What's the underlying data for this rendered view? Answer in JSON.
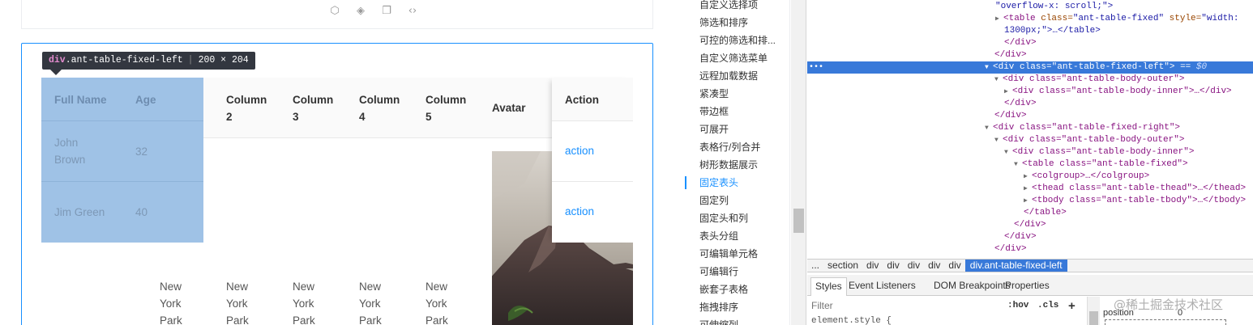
{
  "demo": {
    "toolbar_icons": [
      "codesandbox-icon",
      "codepen-icon",
      "copy-icon",
      "code-expand-icon"
    ],
    "tooltip": {
      "tag": "div",
      "cls": ".ant-table-fixed-left",
      "dims": "200 × 204"
    },
    "columns": {
      "full_name": "Full Name",
      "age": "Age",
      "c2a": "Column",
      "c2b": "2",
      "c3a": "Column",
      "c3b": "3",
      "c4a": "Column",
      "c4b": "4",
      "c5a": "Column",
      "c5b": "5",
      "avatar": "Avatar",
      "action": "Action"
    },
    "rows": [
      {
        "name_a": "John",
        "name_b": "Brown",
        "age": "32",
        "action": "action"
      },
      {
        "name": "Jim Green",
        "age": "40",
        "action": "action"
      }
    ],
    "address": {
      "l1": "New",
      "l2": "York",
      "l3": "Park"
    }
  },
  "sidebar": {
    "items": [
      {
        "label": "自定义选择项"
      },
      {
        "label": "筛选和排序"
      },
      {
        "label": "可控的筛选和排..."
      },
      {
        "label": "自定义筛选菜单"
      },
      {
        "label": "远程加载数据"
      },
      {
        "label": "紧凑型"
      },
      {
        "label": "带边框"
      },
      {
        "label": "可展开"
      },
      {
        "label": "表格行/列合并"
      },
      {
        "label": "树形数据展示"
      },
      {
        "label": "固定表头",
        "active": true
      },
      {
        "label": "固定列"
      },
      {
        "label": "固定头和列"
      },
      {
        "label": "表头分组"
      },
      {
        "label": "可编辑单元格"
      },
      {
        "label": "可编辑行"
      },
      {
        "label": "嵌套子表格"
      },
      {
        "label": "拖拽排序"
      },
      {
        "label": "可伸缩列"
      }
    ]
  },
  "devtools": {
    "lines": {
      "l0": "\"overflow-x: scroll;\">",
      "l1_tag": "<table",
      "l1_attr": " class=",
      "l1_val": "\"ant-table-fixed\"",
      "l1_attr2": " style=",
      "l1_val2": "\"width:",
      "l2": "1300px;\">…</table>",
      "l3": "</div>",
      "l4": "</div>",
      "l5_tag": "<div",
      "l5_attr": " class=",
      "l5_val": "\"ant-table-fixed-left\"",
      "l5_end": ">",
      "l5_eq": " == ",
      "l5_dollar": "$0",
      "l6": "<div class=\"ant-table-body-outer\">",
      "l7": "<div class=\"ant-table-body-inner\">…</div>",
      "l8": "</div>",
      "l9": "</div>",
      "l10": "<div class=\"ant-table-fixed-right\">",
      "l11": "<div class=\"ant-table-body-outer\">",
      "l12": "<div class=\"ant-table-body-inner\">",
      "l13": "<table class=\"ant-table-fixed\">",
      "l14": "<colgroup>…</colgroup>",
      "l15": "<thead class=\"ant-table-thead\">…</thead>",
      "l16": "<tbody class=\"ant-table-tbody\">…</tbody>",
      "l17": "</table>",
      "l18": "</div>",
      "l19": "</div>",
      "l20": "</div>"
    },
    "breadcrumb": [
      "...",
      "section",
      "div",
      "div",
      "div",
      "div",
      "div"
    ],
    "breadcrumb_active": "div.ant-table-fixed-left",
    "tabs": [
      "Styles",
      "Event Listeners",
      "DOM Breakpoints",
      "Properties"
    ],
    "filter_placeholder": "Filter",
    "hov": ":hov",
    "cls": ".cls",
    "plus": "+",
    "element_style": "element.style {",
    "position_label": "position",
    "position_value": "0",
    "selection_dots": "•••"
  },
  "watermark": "@稀土掘金技术社区"
}
